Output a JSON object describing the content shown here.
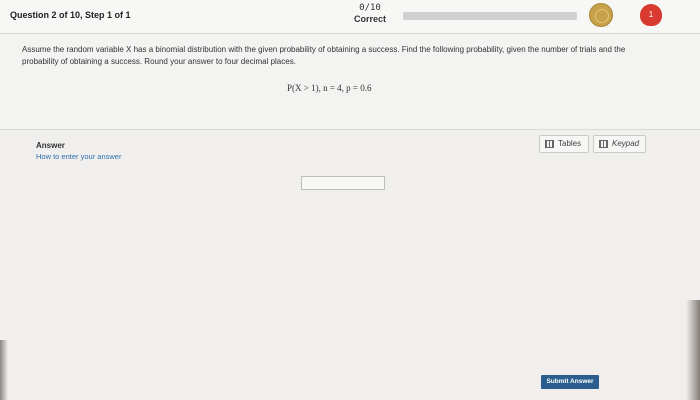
{
  "header": {
    "question_label": "Question 2 of 10, Step 1 of 1",
    "score": "0/10",
    "status": "Correct",
    "progress_fraction": 0.0,
    "heart_count": "1"
  },
  "question": {
    "text": "Assume the random variable X has a binomial distribution with the given probability of obtaining a success. Find the following probability, given the number of trials and the probability of obtaining a success. Round your answer to four decimal places.",
    "formula": "P(X > 1), n = 4, p = 0.6"
  },
  "answer": {
    "label": "Answer",
    "help_link": "How to enter your answer",
    "input_value": ""
  },
  "tools": {
    "tables_label": "Tables",
    "keypad_label": "Keypad"
  },
  "footer": {
    "submit_label": "Submit Answer"
  },
  "colors": {
    "accent": "#2b5e8e",
    "heart": "#d83a2f",
    "coin": "#c8a24a"
  }
}
